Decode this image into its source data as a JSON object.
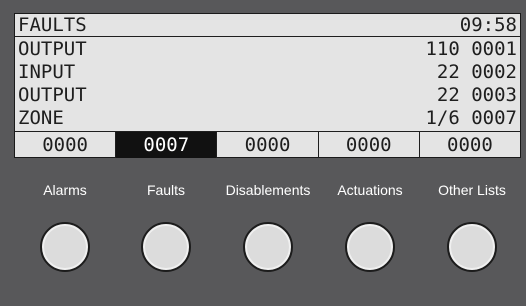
{
  "display": {
    "title": "FAULTS",
    "time": "09:58",
    "rows": [
      {
        "type": "OUTPUT",
        "ref": "110 0001"
      },
      {
        "type": "INPUT",
        "ref": "22 0002"
      },
      {
        "type": "OUTPUT",
        "ref": "22 0003"
      },
      {
        "type": "ZONE",
        "ref": "1/6 0007"
      }
    ],
    "counters": [
      "0000",
      "0007",
      "0000",
      "0000",
      "0000"
    ],
    "active_counter_index": 1
  },
  "buttons": [
    {
      "label": "Alarms"
    },
    {
      "label": "Faults"
    },
    {
      "label": "Disablements"
    },
    {
      "label": "Actuations"
    },
    {
      "label": "Other Lists"
    }
  ],
  "colors": {
    "panel_background": "#58585a",
    "lcd_background": "#e4e4e4",
    "lcd_text": "#1e1e1e",
    "active_counter_background": "#111111",
    "button_label": "#ffffff",
    "knob": "#dcdcdc"
  }
}
